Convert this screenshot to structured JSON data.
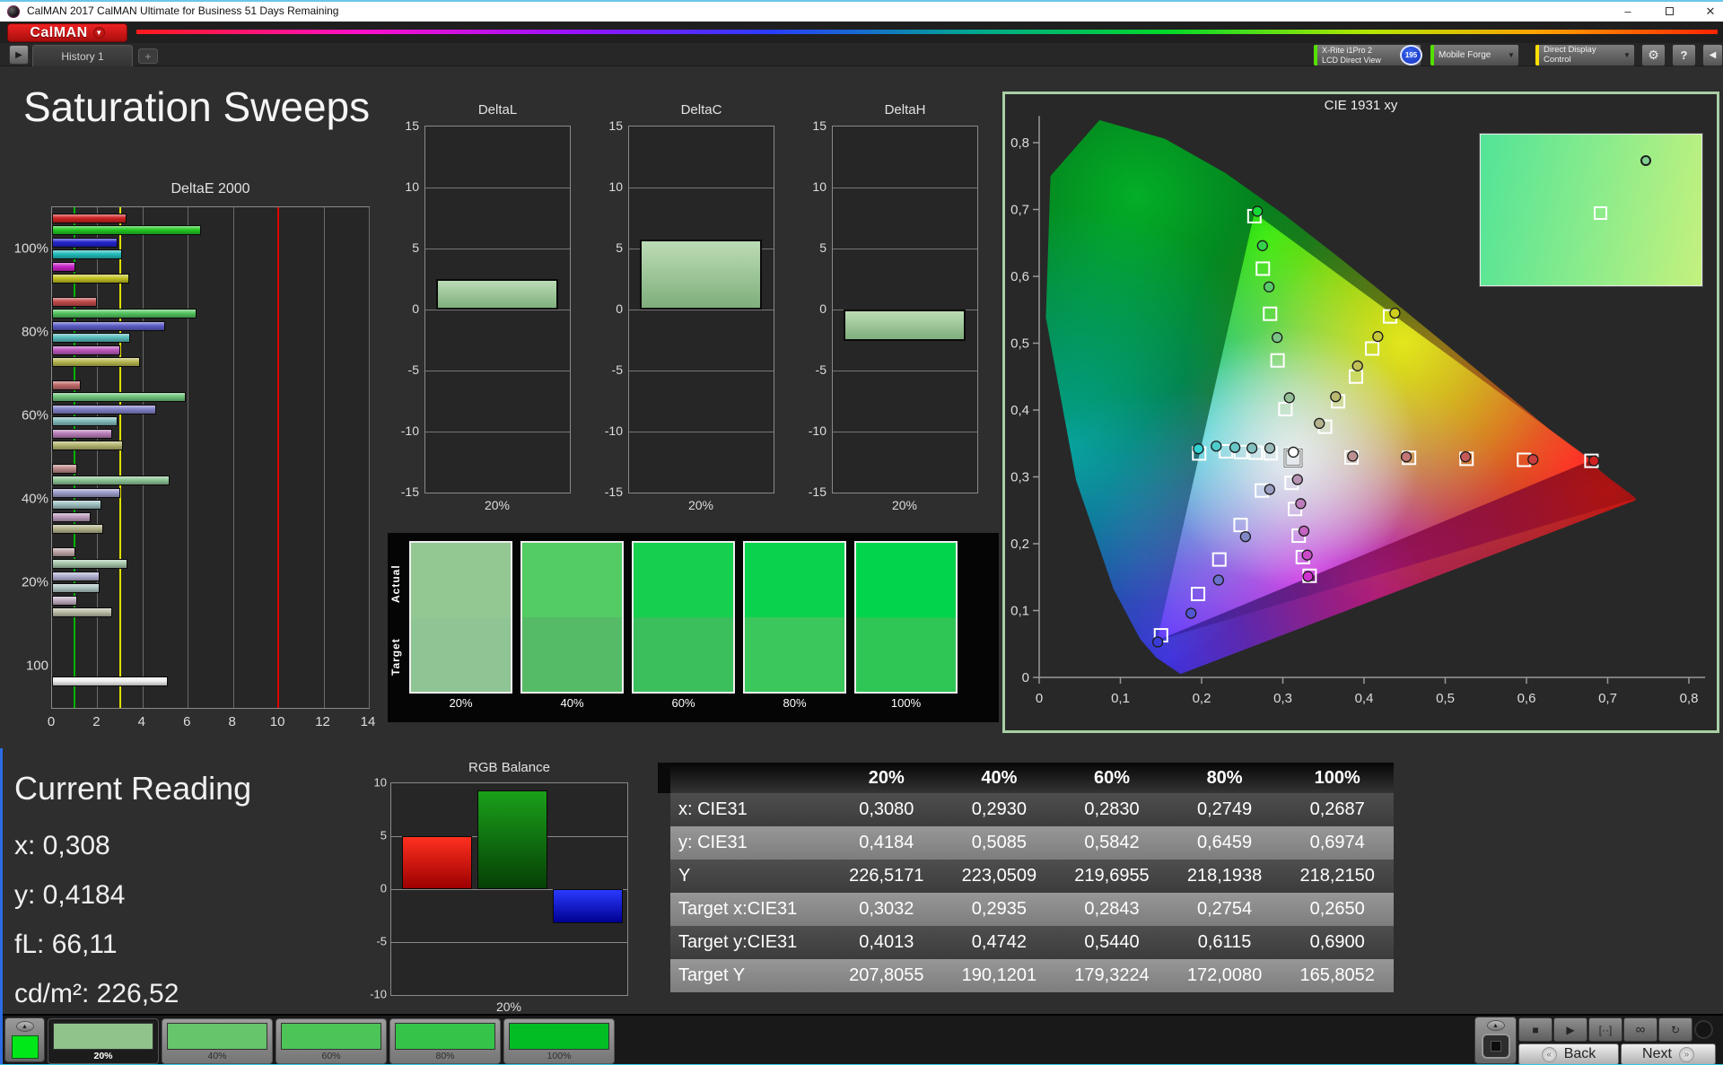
{
  "window": {
    "title": "CalMAN 2017 CalMAN Ultimate for Business 51 Days Remaining",
    "minimize": "–",
    "close": "✕"
  },
  "brand": {
    "logo": "CalMAN",
    "caret": "▼"
  },
  "tabs": {
    "history_tab": "History 1",
    "add_tab": "+",
    "play": "▶"
  },
  "toolbar": {
    "meter": {
      "line1": "X-Rite i1Pro 2",
      "line2": "LCD Direct View",
      "accent": "#55e000"
    },
    "badge": "195",
    "source": {
      "label": "Mobile Forge",
      "accent": "#55e000"
    },
    "ddc": {
      "label": "Direct Display Control",
      "accent": "#ffe000"
    },
    "gear_icon": "⚙",
    "help": "?",
    "collapse_icon": "◀",
    "chevron": "▼"
  },
  "page": {
    "title": "Saturation Sweeps"
  },
  "chart_data": [
    {
      "type": "bar",
      "title": "DeltaE 2000",
      "orientation": "horizontal",
      "xlim": [
        0,
        14
      ],
      "xticks": [
        0,
        2,
        4,
        6,
        8,
        10,
        12,
        14
      ],
      "ref_lines": [
        {
          "value": 1,
          "color": "#00b400"
        },
        {
          "value": 3,
          "color": "#e0e000"
        },
        {
          "value": 10,
          "color": "#e00000"
        }
      ],
      "groups": [
        {
          "label": "100%",
          "bars": [
            {
              "color": "#cc2222",
              "value": 3.3
            },
            {
              "color": "#22c822",
              "value": 6.6
            },
            {
              "color": "#2222cc",
              "value": 2.9
            },
            {
              "color": "#22bcbc",
              "value": 3.1
            },
            {
              "color": "#c822c8",
              "value": 1.05
            },
            {
              "color": "#c2c222",
              "value": 3.4
            }
          ]
        },
        {
          "label": "80%",
          "bars": [
            {
              "color": "#c24a4a",
              "value": 2.0
            },
            {
              "color": "#52c45e",
              "value": 6.4
            },
            {
              "color": "#5c5cc6",
              "value": 5.0
            },
            {
              "color": "#58bcbc",
              "value": 3.45
            },
            {
              "color": "#bc58bc",
              "value": 3.0
            },
            {
              "color": "#b8b852",
              "value": 3.9
            }
          ]
        },
        {
          "label": "60%",
          "bars": [
            {
              "color": "#bd6868",
              "value": 1.25
            },
            {
              "color": "#6ec47a",
              "value": 5.9
            },
            {
              "color": "#8080c8",
              "value": 4.6
            },
            {
              "color": "#82bcbc",
              "value": 2.9
            },
            {
              "color": "#b87eb8",
              "value": 2.65
            },
            {
              "color": "#b4b470",
              "value": 3.15
            }
          ]
        },
        {
          "label": "40%",
          "bars": [
            {
              "color": "#bc8888",
              "value": 1.1
            },
            {
              "color": "#8cc494",
              "value": 5.2
            },
            {
              "color": "#9c9cca",
              "value": 3.0
            },
            {
              "color": "#9ec0c0",
              "value": 2.2
            },
            {
              "color": "#bc9cbc",
              "value": 1.7
            },
            {
              "color": "#b4b48e",
              "value": 2.25
            }
          ]
        },
        {
          "label": "20%",
          "bars": [
            {
              "color": "#bda4a4",
              "value": 1.05
            },
            {
              "color": "#a6c6aa",
              "value": 3.35
            },
            {
              "color": "#b0b0d0",
              "value": 2.1
            },
            {
              "color": "#b0c4c4",
              "value": 2.1
            },
            {
              "color": "#c0aec0",
              "value": 1.1
            },
            {
              "color": "#bcbca6",
              "value": 2.65
            }
          ]
        },
        {
          "label": "100",
          "bars": [
            {
              "color": "#f0f0f0",
              "value": 5.1
            }
          ]
        }
      ]
    },
    {
      "type": "bar",
      "title": "DeltaL",
      "xlabel": "20%",
      "ylim": [
        -15,
        15
      ],
      "yticks": [
        15,
        10,
        5,
        0,
        -5,
        -10,
        -15
      ],
      "values": [
        2.5
      ]
    },
    {
      "type": "bar",
      "title": "DeltaC",
      "xlabel": "20%",
      "ylim": [
        -15,
        15
      ],
      "yticks": [
        15,
        10,
        5,
        0,
        -5,
        -10,
        -15
      ],
      "values": [
        5.7
      ]
    },
    {
      "type": "bar",
      "title": "DeltaH",
      "xlabel": "20%",
      "ylim": [
        -15,
        15
      ],
      "yticks": [
        15,
        10,
        5,
        0,
        -5,
        -10,
        -15
      ],
      "values": [
        -2.6
      ]
    },
    {
      "type": "bar",
      "title": "RGB Balance",
      "xlabel": "20%",
      "ylim": [
        -10,
        10
      ],
      "yticks": [
        10,
        5,
        0,
        -5,
        -10
      ],
      "series": [
        {
          "name": "red",
          "value": 5.0
        },
        {
          "name": "green",
          "value": 9.3
        },
        {
          "name": "blue",
          "value": -3.2
        }
      ],
      "colors": {
        "red": [
          "#ff3020",
          "#9c0000"
        ],
        "green": [
          "#1aa01a",
          "#063f06"
        ],
        "blue": [
          "#2a3aff",
          "#000090"
        ]
      }
    },
    {
      "type": "scatter",
      "title": "CIE 1931 xy",
      "xticks": [
        "0",
        "0,1",
        "0,2",
        "0,3",
        "0,4",
        "0,5",
        "0,6",
        "0,7",
        "0,8"
      ],
      "yticks": [
        "0",
        "0,1",
        "0,2",
        "0,3",
        "0,4",
        "0,5",
        "0,6",
        "0,7",
        "0,8"
      ],
      "xlim": [
        0,
        0.8
      ],
      "ylim": [
        0,
        0.8
      ],
      "white_point": {
        "measured": [
          0.313,
          0.337
        ],
        "target": [
          0.3127,
          0.3285
        ]
      },
      "sweeps": [
        {
          "name": "green",
          "measured": [
            [
              0.308,
              0.4184
            ],
            [
              0.293,
              0.5085
            ],
            [
              0.283,
              0.5842
            ],
            [
              0.2749,
              0.6459
            ],
            [
              0.2687,
              0.6974
            ]
          ],
          "targets": [
            [
              0.3032,
              0.4013
            ],
            [
              0.2935,
              0.4742
            ],
            [
              0.2843,
              0.544
            ],
            [
              0.2754,
              0.6115
            ],
            [
              0.265,
              0.69
            ]
          ],
          "colors": [
            "#93bd97",
            "#79c384",
            "#58ca69",
            "#35d14c",
            "#17d838"
          ]
        },
        {
          "name": "red",
          "measured": [
            [
              0.386,
              0.331
            ],
            [
              0.452,
              0.33
            ],
            [
              0.525,
              0.33
            ],
            [
              0.608,
              0.326
            ],
            [
              0.683,
              0.324
            ]
          ],
          "targets": [
            [
              0.3846,
              0.329
            ],
            [
              0.4554,
              0.3285
            ],
            [
              0.5262,
              0.327
            ],
            [
              0.597,
              0.3255
            ],
            [
              0.68,
              0.324
            ]
          ],
          "colors": [
            "#bb9090",
            "#c17575",
            "#c65a5a",
            "#cb3e3e",
            "#d02222"
          ]
        },
        {
          "name": "blue",
          "measured": [
            [
              0.2838,
              0.2812
            ],
            [
              0.254,
              0.2106
            ],
            [
              0.2208,
              0.1456
            ],
            [
              0.187,
              0.096
            ],
            [
              0.146,
              0.053
            ]
          ],
          "targets": [
            [
              0.2742,
              0.2796
            ],
            [
              0.248,
              0.228
            ],
            [
              0.2218,
              0.1764
            ],
            [
              0.1956,
              0.1248
            ],
            [
              0.15,
              0.063
            ]
          ],
          "colors": [
            "#9a9ec0",
            "#8288c6",
            "#6a70cc",
            "#5256d2",
            "#3a3cd8"
          ]
        },
        {
          "name": "cyan",
          "measured": [
            [
              0.284,
              0.343
            ],
            [
              0.262,
              0.343
            ],
            [
              0.241,
              0.344
            ],
            [
              0.218,
              0.346
            ],
            [
              0.196,
              0.342
            ]
          ],
          "targets": [
            [
              0.2849,
              0.3352
            ],
            [
              0.2666,
              0.3362
            ],
            [
              0.2483,
              0.3372
            ],
            [
              0.23,
              0.3382
            ],
            [
              0.197,
              0.335
            ]
          ],
          "colors": [
            "#9cbcbc",
            "#82c0c0",
            "#68c6c6",
            "#4ecccc",
            "#32d2d2"
          ]
        },
        {
          "name": "magenta",
          "measured": [
            [
              0.318,
              0.296
            ],
            [
              0.322,
              0.26
            ],
            [
              0.326,
              0.219
            ],
            [
              0.33,
              0.183
            ],
            [
              0.331,
              0.151
            ]
          ],
          "targets": [
            [
              0.3108,
              0.291
            ],
            [
              0.315,
              0.252
            ],
            [
              0.3196,
              0.212
            ],
            [
              0.3246,
              0.18
            ],
            [
              0.333,
              0.152
            ]
          ],
          "colors": [
            "#b794b3",
            "#bd7cba",
            "#c463c2",
            "#cb4aca",
            "#d231d2"
          ]
        },
        {
          "name": "yellow",
          "measured": [
            [
              0.345,
              0.38
            ],
            [
              0.365,
              0.42
            ],
            [
              0.392,
              0.466
            ],
            [
              0.417,
              0.51
            ],
            [
              0.438,
              0.545
            ]
          ],
          "targets": [
            [
              0.352,
              0.375
            ],
            [
              0.368,
              0.413
            ],
            [
              0.39,
              0.45
            ],
            [
              0.41,
              0.492
            ],
            [
              0.432,
              0.54
            ]
          ],
          "colors": [
            "#b3b38e",
            "#b9b972",
            "#c0c056",
            "#c7c73a",
            "#cece1e"
          ]
        }
      ],
      "inset": {
        "circle": [
          0.74,
          0.17
        ],
        "square": [
          0.54,
          0.52
        ]
      }
    }
  ],
  "swatches": {
    "row_labels": [
      "Actual",
      "Target"
    ],
    "items": [
      {
        "label": "20%",
        "actual": "#93c893",
        "target": "#8fc494"
      },
      {
        "label": "40%",
        "actual": "#52cc63",
        "target": "#55bb66"
      },
      {
        "label": "60%",
        "actual": "#17cf4e",
        "target": "#3abf5c"
      },
      {
        "label": "80%",
        "actual": "#0bd24d",
        "target": "#3bc75b"
      },
      {
        "label": "100%",
        "actual": "#02d54b",
        "target": "#2fc655"
      }
    ]
  },
  "reading": {
    "title": "Current Reading",
    "lines": [
      "x: 0,308",
      "y: 0,4184",
      "fL: 66,11",
      "cd/m²: 226,52"
    ]
  },
  "table": {
    "columns": [
      "",
      "20%",
      "40%",
      "60%",
      "80%",
      "100%"
    ],
    "rows": [
      {
        "label": "x: CIE31",
        "shade": "dark",
        "values": [
          "0,3080",
          "0,2930",
          "0,2830",
          "0,2749",
          "0,2687"
        ]
      },
      {
        "label": "y: CIE31",
        "shade": "light",
        "values": [
          "0,4184",
          "0,5085",
          "0,5842",
          "0,6459",
          "0,6974"
        ]
      },
      {
        "label": "Y",
        "shade": "dark",
        "values": [
          "226,5171",
          "223,0509",
          "219,6955",
          "218,1938",
          "218,2150"
        ]
      },
      {
        "label": "Target x:CIE31",
        "shade": "light",
        "values": [
          "0,3032",
          "0,2935",
          "0,2843",
          "0,2754",
          "0,2650"
        ]
      },
      {
        "label": "Target y:CIE31",
        "shade": "dark",
        "values": [
          "0,4013",
          "0,4742",
          "0,5440",
          "0,6115",
          "0,6900"
        ]
      },
      {
        "label": "Target Y",
        "shade": "light",
        "values": [
          "207,8055",
          "190,1201",
          "179,3224",
          "172,0080",
          "165,8052"
        ]
      }
    ]
  },
  "bottom": {
    "patches": [
      {
        "label": "20%",
        "color": "#90c28c",
        "selected": true
      },
      {
        "label": "40%",
        "color": "#66c46a",
        "selected": false
      },
      {
        "label": "60%",
        "color": "#4cc457",
        "selected": false
      },
      {
        "label": "80%",
        "color": "#35c449",
        "selected": false
      },
      {
        "label": "100%",
        "color": "#02bd24",
        "selected": false
      }
    ],
    "transport_icons": [
      "■",
      "▶",
      "[··]",
      "∞",
      "↻"
    ],
    "back": "Back",
    "next": "Next",
    "back_chevron": "«",
    "next_chevron": "»",
    "up_arrow": "▲"
  }
}
